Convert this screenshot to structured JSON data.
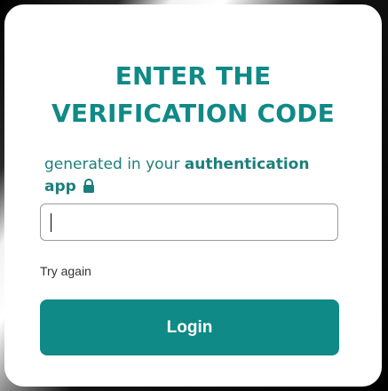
{
  "dialog": {
    "title_line1": "ENTER THE",
    "title_line2": "VERIFICATION CODE",
    "subtitle_prefix": "generated in your ",
    "subtitle_strong": "authentication app",
    "subtitle_icon": "lock-icon"
  },
  "form": {
    "code_value": "",
    "code_placeholder": "",
    "try_again_label": "Try again",
    "login_label": "Login"
  },
  "colors": {
    "accent": "#0F8A86",
    "card": "#FFFFFF",
    "button_text": "#FFFFFF"
  }
}
